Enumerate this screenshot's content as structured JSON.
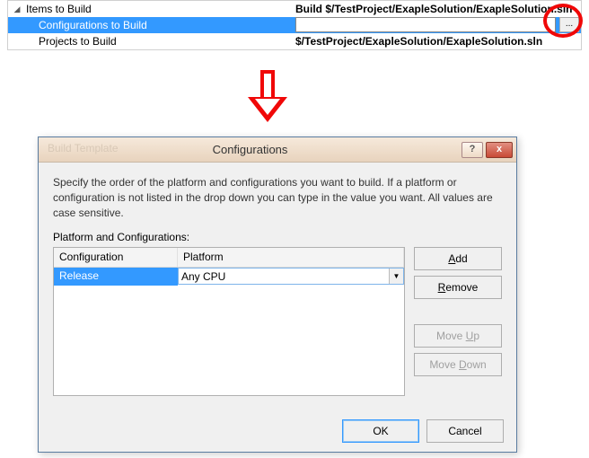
{
  "tree": {
    "parent": "Items to Build",
    "child_selected": "Configurations to Build",
    "child2": "Projects to Build"
  },
  "rightValues": {
    "row0": "Build $/TestProject/ExapleSolution/ExapleSolution.sln",
    "row1": "",
    "row2": "$/TestProject/ExapleSolution/ExapleSolution.sln",
    "ellipsis": "..."
  },
  "dialog": {
    "ghost": "Build Template",
    "title": "Configurations",
    "help": "?",
    "close": "x",
    "description": "Specify the order of the platform and configurations you want to build. If a platform or configuration is not listed in the drop down you can type in the value you want. All values are case sensitive.",
    "listLabel": "Platform and Configurations:",
    "headers": {
      "config": "Configuration",
      "platform": "Platform"
    },
    "row": {
      "config": "Release",
      "platform": "Any CPU"
    },
    "buttons": {
      "add_pre": "",
      "add_u": "A",
      "add_post": "dd",
      "remove_pre": "",
      "remove_u": "R",
      "remove_post": "emove",
      "moveup_pre": "Move ",
      "moveup_u": "U",
      "moveup_post": "p",
      "movedown_pre": "Move ",
      "movedown_u": "D",
      "movedown_post": "own",
      "ok": "OK",
      "cancel": "Cancel"
    }
  }
}
